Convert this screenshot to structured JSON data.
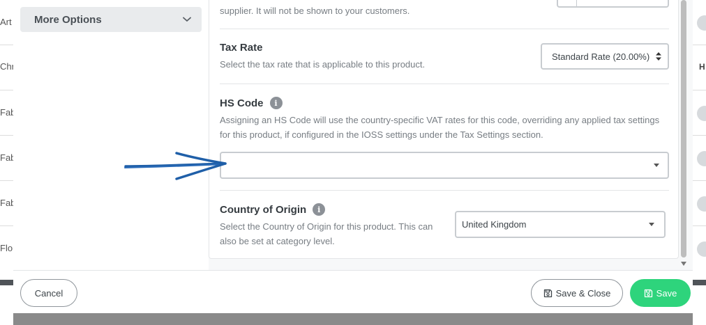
{
  "background": {
    "left_rows": [
      "Art",
      "Chr",
      "Fab",
      "Fab",
      "Fab",
      "Flo"
    ],
    "right_header": "H"
  },
  "sidebar": {
    "more_options_label": "More Options",
    "more_options_icon": "chevron-down-icon"
  },
  "fields": {
    "supplier_note": {
      "description": "supplier. It will not be shown to your customers."
    },
    "tax_rate": {
      "title": "Tax Rate",
      "description": "Select the tax rate that is applicable to this product.",
      "selected": "Standard Rate (20.00%)"
    },
    "hs_code": {
      "title": "HS Code",
      "info_icon": "i",
      "description": "Assigning an HS Code will use the country-specific VAT rates for this code, overriding any applied tax settings for this product, if configured in the IOSS settings under the Tax Settings section.",
      "selected": ""
    },
    "country_of_origin": {
      "title": "Country of Origin",
      "info_icon": "i",
      "description": "Select the Country of Origin for this product. This can also be set at category level.",
      "selected": "United Kingdom"
    }
  },
  "footer": {
    "cancel_label": "Cancel",
    "save_close_label": "Save & Close",
    "save_label": "Save"
  },
  "colors": {
    "save_green": "#2ed47c",
    "annotation_arrow": "#1f5fa8"
  }
}
